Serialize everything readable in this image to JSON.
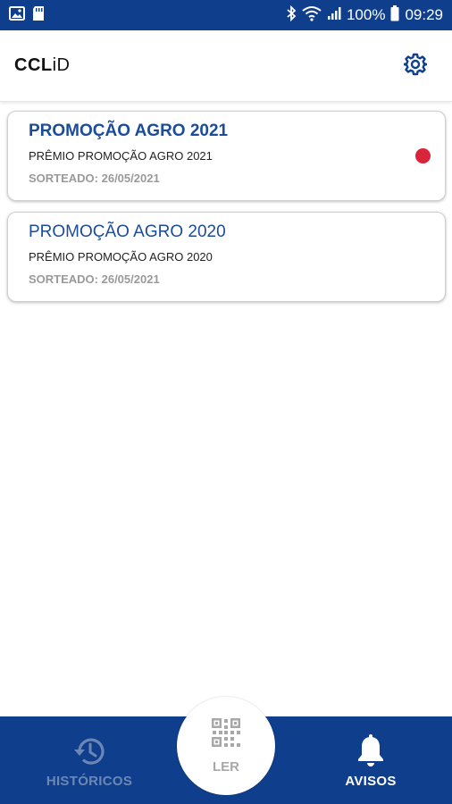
{
  "status_bar": {
    "battery": "100%",
    "time": "09:29",
    "icons": [
      "gallery-icon",
      "sd-card-icon",
      "bluetooth-icon",
      "wifi-icon",
      "signal-icon",
      "battery-icon"
    ]
  },
  "header": {
    "logo_main": "CCL",
    "logo_suffix": "iD",
    "settings_icon": "gear-icon"
  },
  "notifications": [
    {
      "title": "PROMOÇÃO AGRO 2021",
      "subtitle": "PRÊMIO PROMOÇÃO AGRO 2021",
      "date": "SORTEADO: 26/05/2021",
      "unread": true
    },
    {
      "title": "PROMOÇÃO AGRO 2020",
      "subtitle": "PRÊMIO PROMOÇÃO AGRO 2020",
      "date": "SORTEADO: 26/05/2021",
      "unread": false
    }
  ],
  "bottom_nav": {
    "historicos_label": "HISTÓRICOS",
    "ler_label": "LER",
    "avisos_label": "AVISOS",
    "active": "AVISOS"
  },
  "colors": {
    "primary": "#0f3f8c",
    "title_blue": "#1b4c99",
    "unread_dot": "#d9243a",
    "inactive_nav": "#6d87b5"
  }
}
